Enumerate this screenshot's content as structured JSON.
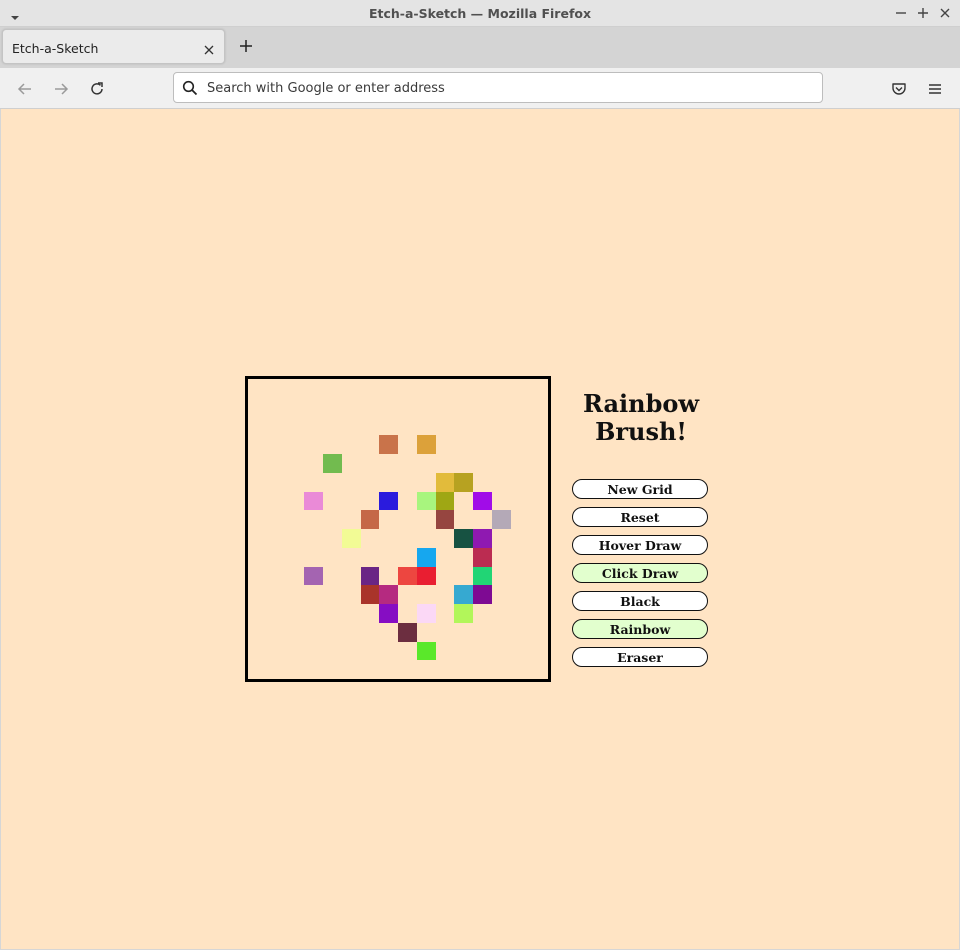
{
  "window": {
    "title": "Etch-a-Sketch — Mozilla Firefox"
  },
  "tab": {
    "label": "Etch-a-Sketch"
  },
  "urlbar": {
    "placeholder": "Search with Google or enter address",
    "value": ""
  },
  "page": {
    "background": "#ffe4c4"
  },
  "app": {
    "heading": "Rainbow Brush!",
    "grid_size": 16,
    "buttons": {
      "new_grid": "New Grid",
      "reset": "Reset",
      "hover_draw": "Hover Draw",
      "click_draw": "Click Draw",
      "black": "Black",
      "rainbow": "Rainbow",
      "eraser": "Eraser"
    },
    "active_buttons": [
      "click_draw",
      "rainbow"
    ],
    "active_color": "#e2ffce",
    "painted_cells": [
      {
        "row": 3,
        "col": 7,
        "color": "#c9734a"
      },
      {
        "row": 3,
        "col": 9,
        "color": "#dca13a"
      },
      {
        "row": 4,
        "col": 4,
        "color": "#72bb4f"
      },
      {
        "row": 5,
        "col": 10,
        "color": "#e2bb3b"
      },
      {
        "row": 5,
        "col": 11,
        "color": "#b7a221"
      },
      {
        "row": 6,
        "col": 3,
        "color": "#ea8ad7"
      },
      {
        "row": 6,
        "col": 7,
        "color": "#2a1bdd"
      },
      {
        "row": 6,
        "col": 9,
        "color": "#a8f57e"
      },
      {
        "row": 6,
        "col": 10,
        "color": "#9fa714"
      },
      {
        "row": 6,
        "col": 12,
        "color": "#a10ce8"
      },
      {
        "row": 7,
        "col": 6,
        "color": "#c56847"
      },
      {
        "row": 7,
        "col": 10,
        "color": "#964540"
      },
      {
        "row": 7,
        "col": 13,
        "color": "#b4a9b7"
      },
      {
        "row": 8,
        "col": 5,
        "color": "#f2fb95"
      },
      {
        "row": 8,
        "col": 11,
        "color": "#175242"
      },
      {
        "row": 8,
        "col": 12,
        "color": "#8f19b1"
      },
      {
        "row": 9,
        "col": 9,
        "color": "#16a7ef"
      },
      {
        "row": 9,
        "col": 12,
        "color": "#bb2c51"
      },
      {
        "row": 10,
        "col": 3,
        "color": "#a464b1"
      },
      {
        "row": 10,
        "col": 6,
        "color": "#6a2585"
      },
      {
        "row": 10,
        "col": 8,
        "color": "#ed4640"
      },
      {
        "row": 10,
        "col": 9,
        "color": "#e91e31"
      },
      {
        "row": 10,
        "col": 12,
        "color": "#21d575"
      },
      {
        "row": 11,
        "col": 6,
        "color": "#a9342a"
      },
      {
        "row": 11,
        "col": 7,
        "color": "#b52a80"
      },
      {
        "row": 11,
        "col": 11,
        "color": "#36a9d1"
      },
      {
        "row": 11,
        "col": 12,
        "color": "#7e0a93"
      },
      {
        "row": 12,
        "col": 7,
        "color": "#860dc3"
      },
      {
        "row": 12,
        "col": 9,
        "color": "#fbd8f6"
      },
      {
        "row": 12,
        "col": 11,
        "color": "#b2f65a"
      },
      {
        "row": 13,
        "col": 8,
        "color": "#6c2e40"
      },
      {
        "row": 14,
        "col": 9,
        "color": "#5ae82a"
      }
    ]
  }
}
